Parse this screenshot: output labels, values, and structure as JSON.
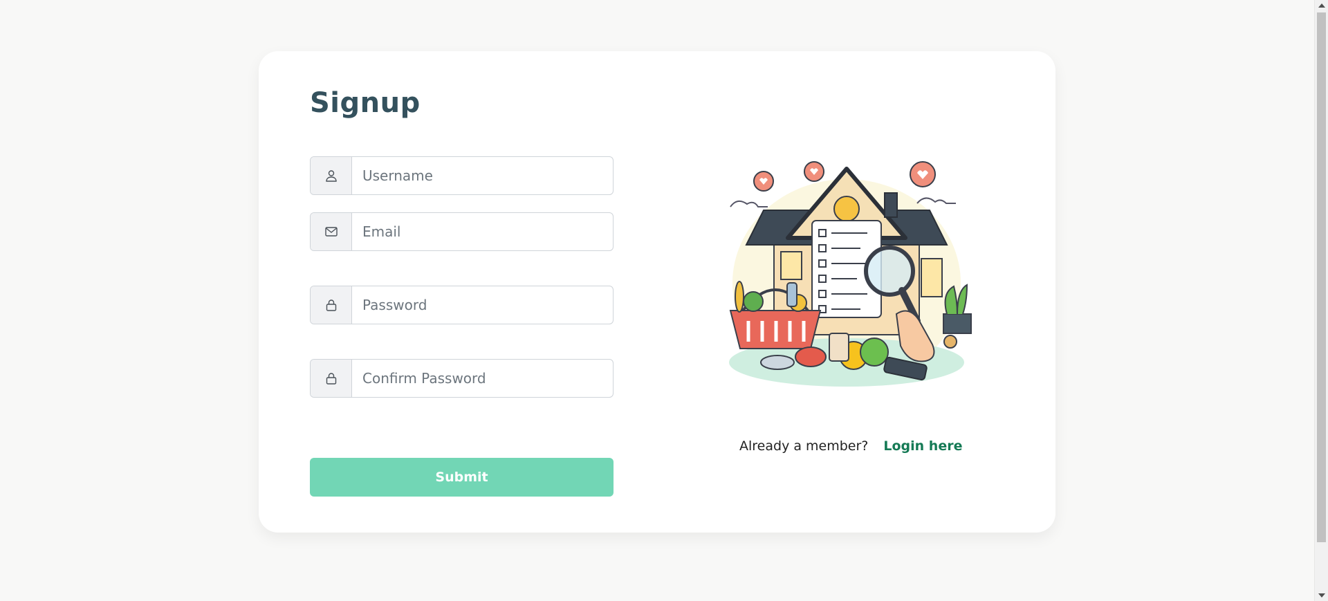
{
  "form": {
    "title": "Signup",
    "username": {
      "placeholder": "Username",
      "icon": "user-icon"
    },
    "email": {
      "placeholder": "Email",
      "icon": "envelope-icon"
    },
    "password": {
      "placeholder": "Password",
      "icon": "lock-icon"
    },
    "confirm_password": {
      "placeholder": "Confirm Password",
      "icon": "lock-icon"
    },
    "submit_label": "Submit"
  },
  "aside": {
    "illustration": "house-grocery-checklist-illustration",
    "member_text": "Already a member?",
    "login_link": "Login here"
  },
  "colors": {
    "title": "#34515d",
    "submit": "#72d6b5",
    "link": "#157a55",
    "background": "#f8f8f7"
  }
}
